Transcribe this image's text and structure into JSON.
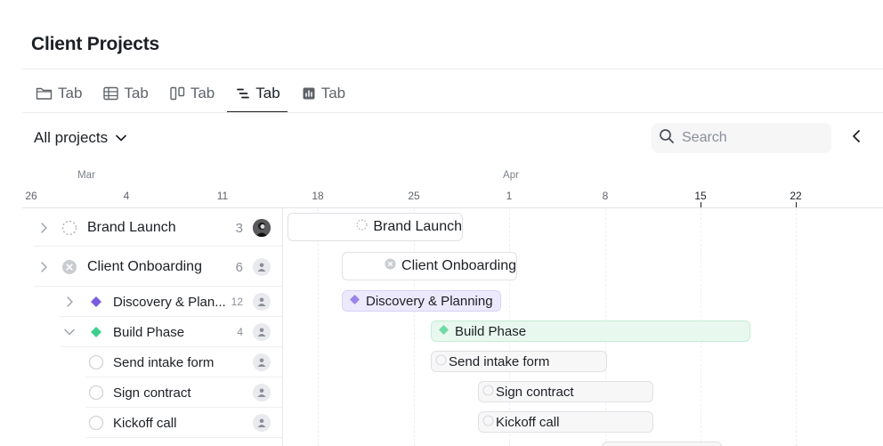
{
  "page": {
    "title": "Client Projects"
  },
  "tabs": [
    {
      "label": "Tab",
      "icon": "folder-icon",
      "active": false
    },
    {
      "label": "Tab",
      "icon": "table-icon",
      "active": false
    },
    {
      "label": "Tab",
      "icon": "board-icon",
      "active": false
    },
    {
      "label": "Tab",
      "icon": "timeline-icon",
      "active": true
    },
    {
      "label": "Tab",
      "icon": "chart-icon",
      "active": false
    }
  ],
  "toolbar": {
    "scope_label": "All projects",
    "search_placeholder": "Search"
  },
  "timeline": {
    "months": [
      "Mar",
      "Apr"
    ],
    "days": [
      "26",
      "4",
      "11",
      "18",
      "25",
      "1",
      "8",
      "15",
      "22"
    ]
  },
  "rows": [
    {
      "label": "Brand Launch",
      "count": "3",
      "status": "in-progress",
      "avatar": "photo"
    },
    {
      "label": "Client Onboarding",
      "count": "6",
      "status": "cancelled",
      "avatar": "empty"
    },
    {
      "label": "Discovery & Plan...",
      "count": "12",
      "status": "milestone-purple",
      "avatar": "empty"
    },
    {
      "label": "Build Phase",
      "count": "4",
      "status": "milestone-green",
      "avatar": "empty"
    },
    {
      "label": "Send intake form",
      "count": "",
      "status": "todo",
      "avatar": "empty"
    },
    {
      "label": "Sign contract",
      "count": "",
      "status": "todo",
      "avatar": "empty"
    },
    {
      "label": "Kickoff call",
      "count": "",
      "status": "todo",
      "avatar": "empty"
    }
  ],
  "bars": [
    {
      "label": "Brand Launch"
    },
    {
      "label": "Client Onboarding"
    },
    {
      "label": "Discovery & Planning"
    },
    {
      "label": "Build Phase"
    },
    {
      "label": "Send intake form"
    },
    {
      "label": "Sign contract"
    },
    {
      "label": "Kickoff call"
    }
  ],
  "colors": {
    "milestone_purple": "#7b5ce0",
    "milestone_green": "#3ecf8e",
    "text": "#1c1f24",
    "muted": "#8a8f98"
  }
}
